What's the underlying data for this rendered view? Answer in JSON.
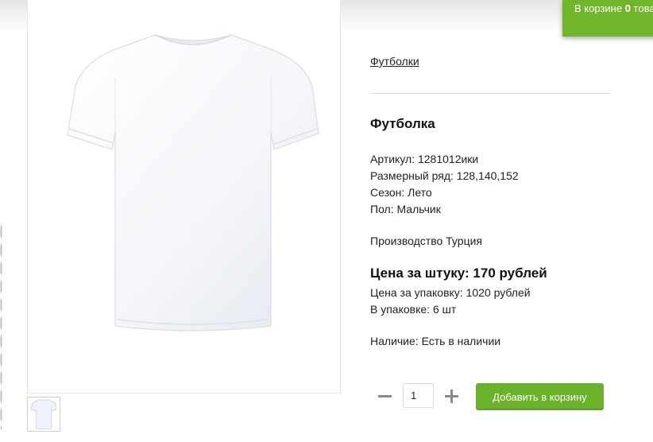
{
  "cart": {
    "prefix": "В корзине ",
    "count": "0",
    "suffix": " товаров"
  },
  "breadcrumb": "Футболки",
  "product": {
    "title": "Футболка",
    "attributes": [
      "Артикул: 1281012ики",
      "Размерный ряд: 128,140,152",
      "Сезон: Лето",
      "Пол: Мальчик"
    ],
    "origin": "Производство Турция",
    "price_main": "Цена за штуку: 170 рублей",
    "price_pack": "Цена за упаковку: 1020 рублей",
    "pack_qty": "В упаковке: 6 шт",
    "stock": "Наличие: Есть в наличии"
  },
  "order": {
    "quantity": "1",
    "add_label": "Добавить в корзину",
    "minus_icon": "minus-icon",
    "plus_icon": "plus-icon"
  },
  "colors": {
    "accent": "#6ab22a",
    "cart_badge": "#6fb62b",
    "divider": "#dddddd"
  }
}
